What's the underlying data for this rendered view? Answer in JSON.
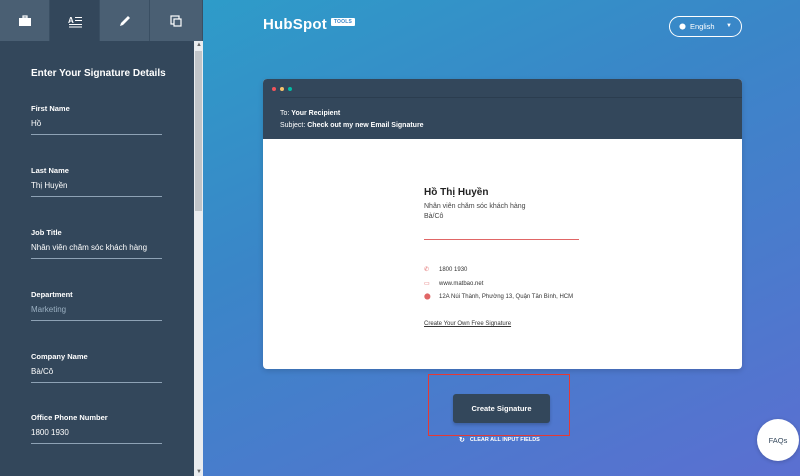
{
  "sidebar": {
    "tabs": [
      {
        "icon": "briefcase-icon",
        "active": false
      },
      {
        "icon": "text-align-icon",
        "active": true
      },
      {
        "icon": "pencil-icon",
        "active": false
      },
      {
        "icon": "copy-icon",
        "active": false
      }
    ],
    "form_title": "Enter Your Signature Details",
    "fields": [
      {
        "label": "First Name",
        "value": "Hồ",
        "placeholder": ""
      },
      {
        "label": "Last Name",
        "value": "Thị Huyền",
        "placeholder": ""
      },
      {
        "label": "Job Title",
        "value": "Nhân viên chăm sóc khách hàng",
        "placeholder": ""
      },
      {
        "label": "Department",
        "value": "",
        "placeholder": "Marketing"
      },
      {
        "label": "Company Name",
        "value": "Bà/Cô",
        "placeholder": ""
      },
      {
        "label": "Office Phone Number",
        "value": "1800 1930",
        "placeholder": ""
      }
    ]
  },
  "header": {
    "logo_text": "HubSpot",
    "logo_badge": "TOOLS",
    "language": "English"
  },
  "preview": {
    "to_label": "To:",
    "to_value": "Your Recipient",
    "subject_label": "Subject:",
    "subject_value": "Check out my new Email Signature",
    "dot_colors": [
      "#f2545b",
      "#f5c26b",
      "#00bda5"
    ],
    "signature": {
      "name": "Hồ Thị Huyền",
      "job": "Nhân viên chăm sóc khách hàng",
      "company": "Bà/Cô",
      "phone": "1800 1930",
      "website": "www.matbao.net",
      "address": "12A Núi Thành, Phường 13, Quận Tân Bình, HCM",
      "link": "Create Your Own Free Signature"
    }
  },
  "actions": {
    "create_label": "Create Signature",
    "clear_label": "CLEAR ALL INPUT FIELDS",
    "faq_label": "FAQs"
  },
  "colors": {
    "accent_dark": "#33475b",
    "highlight_frame": "#e53935",
    "signature_accent": "#e06666"
  }
}
